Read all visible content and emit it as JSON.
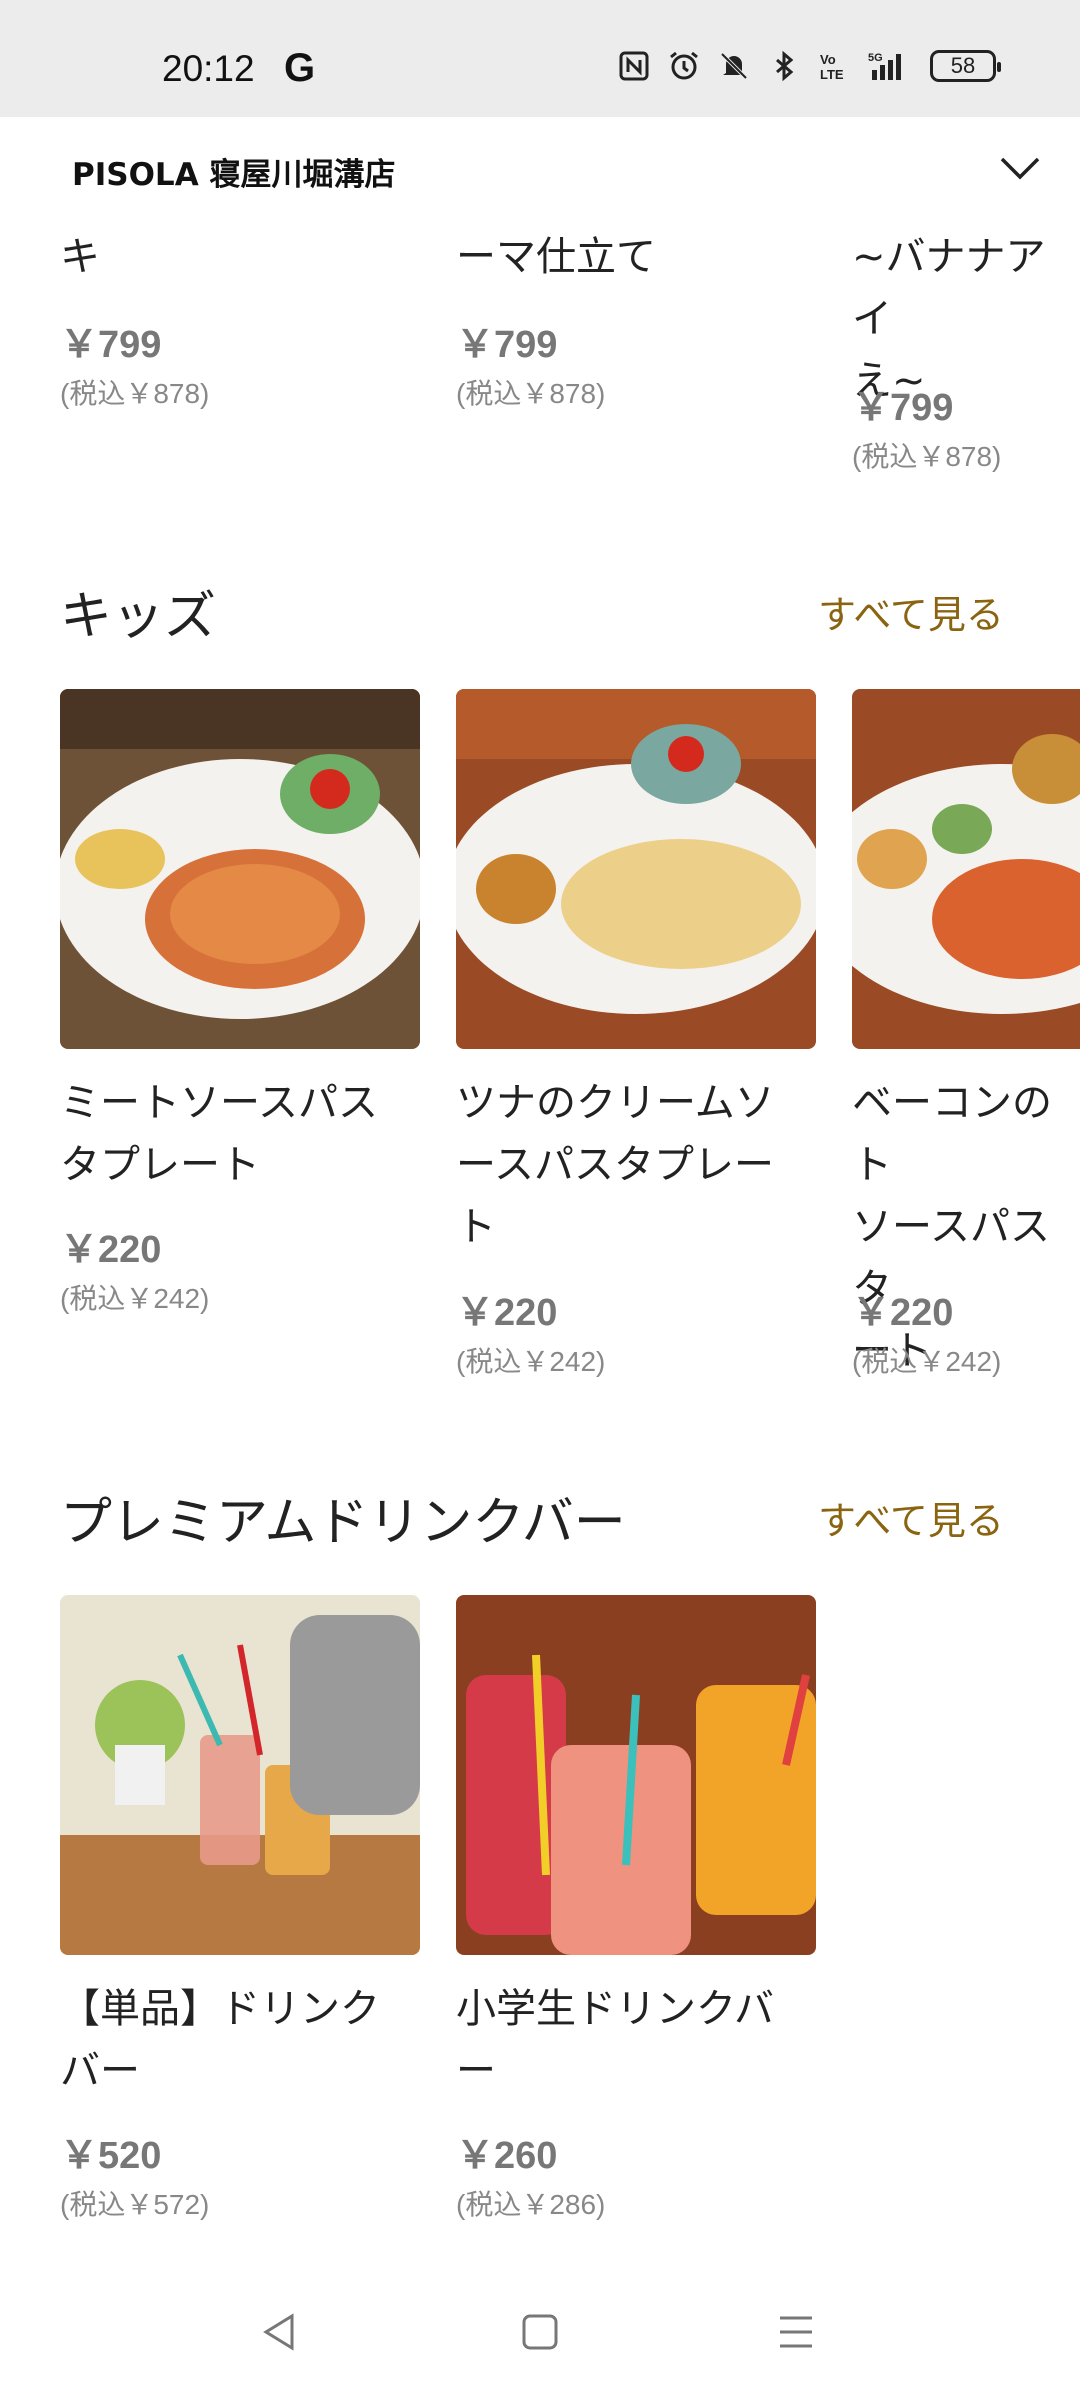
{
  "status_bar": {
    "time": "20:12",
    "g_label": "G",
    "battery": "58",
    "icons": [
      "nfc-icon",
      "alarm-icon",
      "mute-icon",
      "bluetooth-icon",
      "volte-icon",
      "signal-5g-icon"
    ]
  },
  "header": {
    "store_name": "PISOLA 寝屋川堀溝店"
  },
  "top_row": [
    {
      "name": "キ",
      "price": "￥799",
      "tax": "(税込￥878)"
    },
    {
      "name": "ーマ仕立て",
      "price": "￥799",
      "tax": "(税込￥878)"
    },
    {
      "name": "~バナナアイ\nえ~",
      "price": "￥799",
      "tax": "(税込￥878)"
    }
  ],
  "kids": {
    "title": "キッズ",
    "see_all": "すべて見る",
    "items": [
      {
        "name": "ミートソースパス\nタプレート",
        "price": "￥220",
        "tax": "(税込￥242)"
      },
      {
        "name": "ツナのクリームソ\nースパスタプレー\nト",
        "price": "￥220",
        "tax": "(税込￥242)"
      },
      {
        "name": "ベーコンのト\nソースパスタ\nート",
        "price": "￥220",
        "tax": "(税込￥242)"
      }
    ]
  },
  "drinks": {
    "title": "プレミアムドリンクバー",
    "see_all": "すべて見る",
    "items": [
      {
        "name": "【単品】ドリンク\nバー",
        "price": "￥520",
        "tax": "(税込￥572)"
      },
      {
        "name": "小学生ドリンクバ\nー",
        "price": "￥260",
        "tax": "(税込￥286)"
      }
    ]
  },
  "colors": {
    "accent": "#8a6410",
    "price": "#777777",
    "status_bar_bg": "#ececec"
  }
}
